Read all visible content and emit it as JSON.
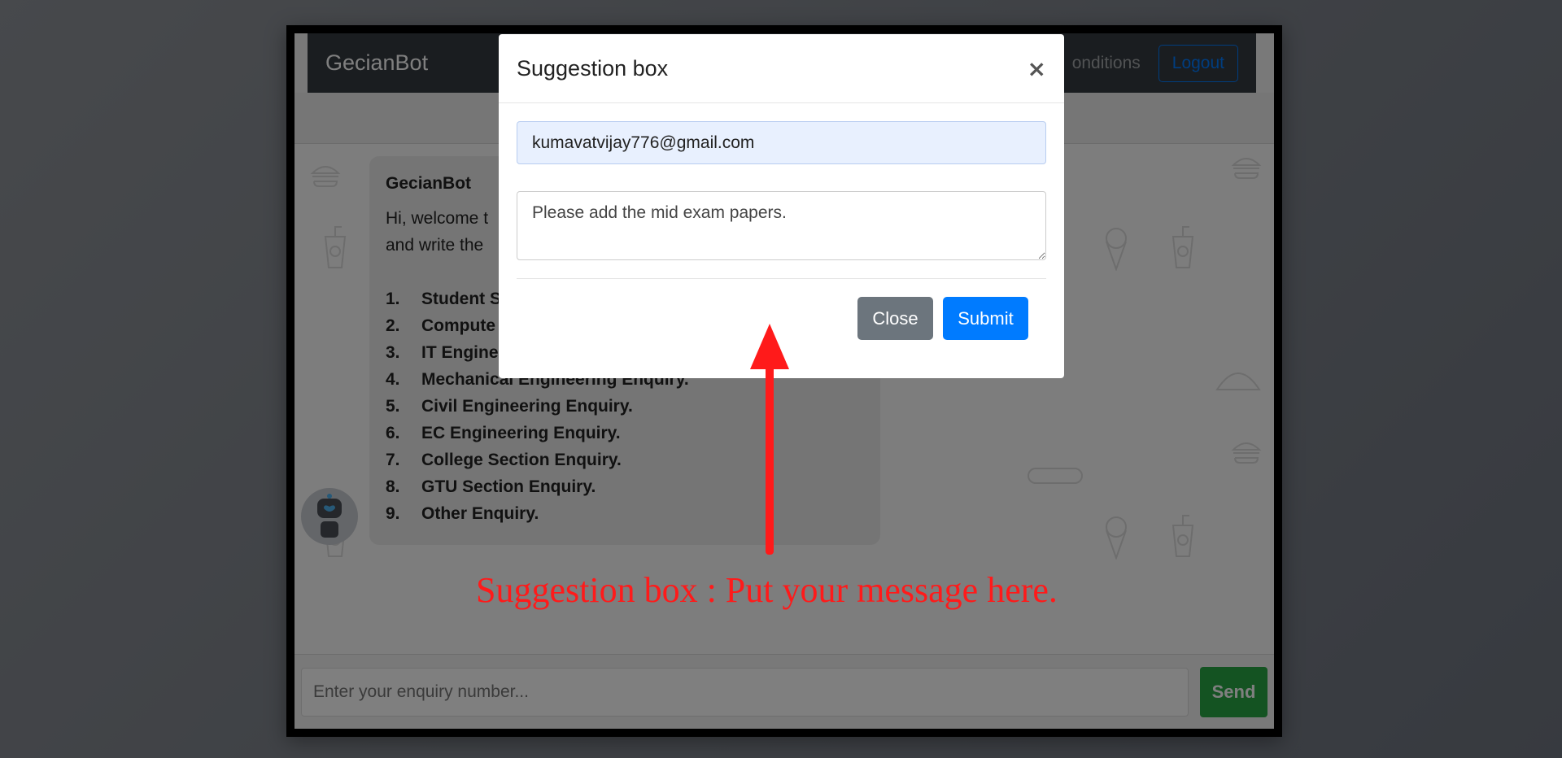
{
  "app": {
    "brand": "GecianBot",
    "nav_link_partial": "onditions",
    "logout_label": "Logout"
  },
  "chat": {
    "sender": "GecianBot",
    "intro_visible": "Hi, welcome t\nand write the",
    "items": [
      {
        "num": "1.",
        "label": "Student S"
      },
      {
        "num": "2.",
        "label": "Compute"
      },
      {
        "num": "3.",
        "label": "IT Engine"
      },
      {
        "num": "4.",
        "label": "Mechanical Engineering Enquiry."
      },
      {
        "num": "5.",
        "label": "Civil Engineering Enquiry."
      },
      {
        "num": "6.",
        "label": "EC Engineering Enquiry."
      },
      {
        "num": "7.",
        "label": "College Section Enquiry."
      },
      {
        "num": "8.",
        "label": "GTU Section Enquiry."
      },
      {
        "num": "9.",
        "label": "Other Enquiry."
      }
    ]
  },
  "footer": {
    "input_placeholder": "Enter your enquiry number...",
    "send_label": "Send"
  },
  "modal": {
    "title": "Suggestion box",
    "close_icon": "×",
    "email_value": "kumavatvijay776@gmail.com",
    "message_value": "Please add the mid exam papers.",
    "close_label": "Close",
    "submit_label": "Submit"
  },
  "annotation": {
    "text": "Suggestion box : Put your message here.",
    "color": "#ff1a1a"
  },
  "colors": {
    "navbar": "#343a40",
    "primary": "#007bff",
    "success": "#28a745",
    "secondary": "#6c757d"
  }
}
